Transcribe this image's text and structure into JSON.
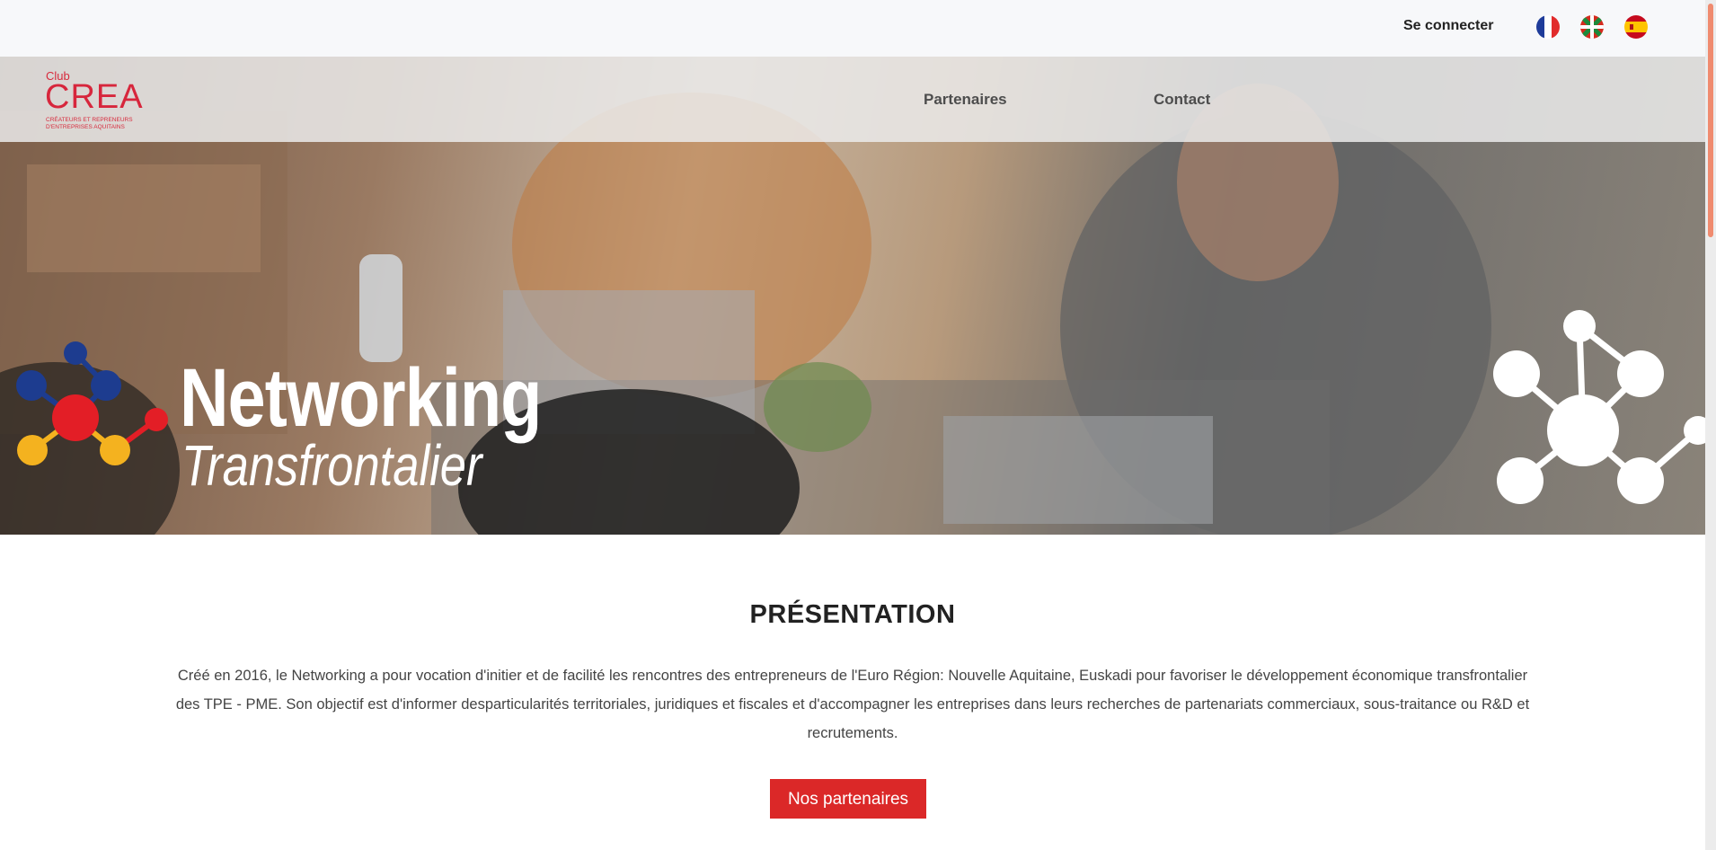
{
  "topbar": {
    "login_label": "Se connecter"
  },
  "languages": [
    {
      "code": "fr",
      "icon": "french-flag-icon"
    },
    {
      "code": "eu",
      "icon": "basque-flag-icon"
    },
    {
      "code": "es",
      "icon": "spanish-flag-icon"
    }
  ],
  "logo": {
    "club": "Club",
    "name": "CREA",
    "line1": "CRÉATEURS ET REPRENEURS",
    "line2": "D'ENTREPRISES AQUITAINS"
  },
  "nav": {
    "items": [
      "Partenaires",
      "Contact"
    ]
  },
  "hero": {
    "title": "Networking",
    "subtitle": "Transfrontalier"
  },
  "presentation": {
    "title": "PRÉSENTATION",
    "text": "Créé en 2016, le Networking a pour vocation d'initier et de facilité les rencontres des entrepreneurs de l'Euro Région: Nouvelle Aquitaine, Euskadi pour favoriser le développement économique transfrontalier des TPE - PME. Son objectif est d'informer desparticularités territoriales, juridiques et fiscales et d'accompagner les entreprises dans leurs recherches de partenariats commerciaux, sous-traitance ou R&D et recrutements.",
    "button_label": "Nos partenaires"
  },
  "colors": {
    "accent": "#db2828",
    "brand": "#d7263c",
    "topbar_bg": "#f7f8fa"
  }
}
